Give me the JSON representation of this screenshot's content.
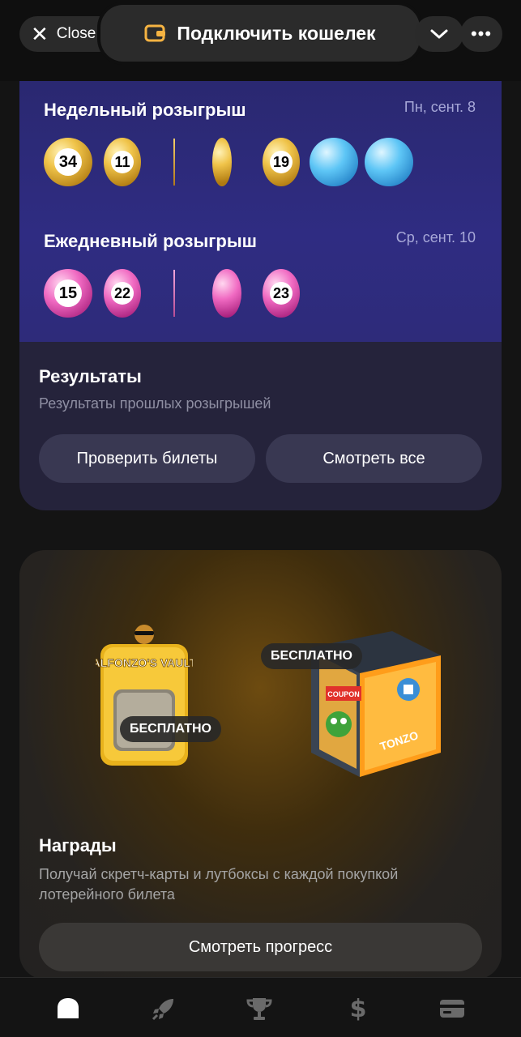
{
  "topbar": {
    "close_label": "Close",
    "wallet_label": "Подключить кошелек",
    "icons": [
      "close-icon",
      "wallet-icon",
      "chevron-down-icon",
      "more-icon"
    ]
  },
  "weekly": {
    "title": "Недельный розыгрыш",
    "date": "Пн, сент. 8",
    "balls_left": [
      "34",
      "11"
    ],
    "balls_right": [
      "",
      "19",
      "",
      ""
    ]
  },
  "daily": {
    "title": "Ежедневный розыгрыш",
    "date": "Ср, сент. 10",
    "balls_left": [
      "15",
      "22"
    ],
    "balls_right": [
      "",
      "23"
    ]
  },
  "results": {
    "title": "Результаты",
    "subtitle": "Результаты прошлых розыгрышей",
    "check_button": "Проверить билеты",
    "view_all_button": "Смотреть все"
  },
  "rewards": {
    "vault_logo_text": "ALFONZO'S VAULT",
    "box_logo_text": "TONZO",
    "coupon_text": "COUPON",
    "vault_badge": "БЕСПЛАТНО",
    "box_badge": "БЕСПЛАТНО",
    "title": "Награды",
    "subtitle": "Получай скретч-карты и лутбоксы с каждой покупкой лотерейного билета",
    "progress_button": "Смотреть прогресс"
  },
  "nav": {
    "items": [
      "home-icon",
      "rocket-icon",
      "trophy-icon",
      "dollar-icon",
      "card-icon"
    ],
    "active": "home-icon"
  },
  "colors": {
    "lottery_top": "#2f2c82",
    "lottery_bottom": "#25233b",
    "gold": "#f0c44a",
    "pink": "#f06ac2",
    "blue": "#5ec6f6",
    "wallet_icon": "#f5b342"
  }
}
